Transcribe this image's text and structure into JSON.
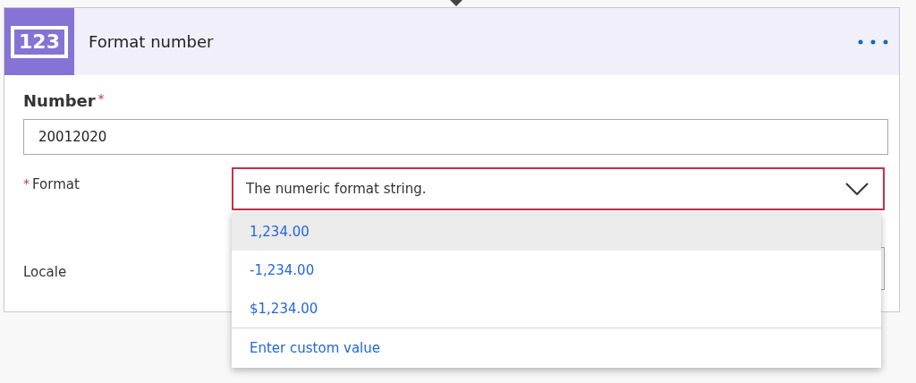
{
  "card": {
    "icon_text": "123",
    "title": "Format number"
  },
  "fields": [
    {
      "kind": "stacked",
      "label": "Number",
      "required_mark": "*",
      "value": "20012020",
      "error": false
    },
    {
      "kind": "inline",
      "label": "Format",
      "required_mark": "*",
      "placeholder": "The numeric format string.",
      "error": true,
      "expanded": true,
      "options": [
        {
          "label": "1,234.00",
          "highlighted": true
        },
        {
          "label": "-1,234.00",
          "highlighted": false
        },
        {
          "label": "$1,234.00",
          "highlighted": false
        }
      ],
      "custom_option": "Enter custom value"
    },
    {
      "kind": "inline",
      "label": "Locale",
      "error": false
    }
  ]
}
